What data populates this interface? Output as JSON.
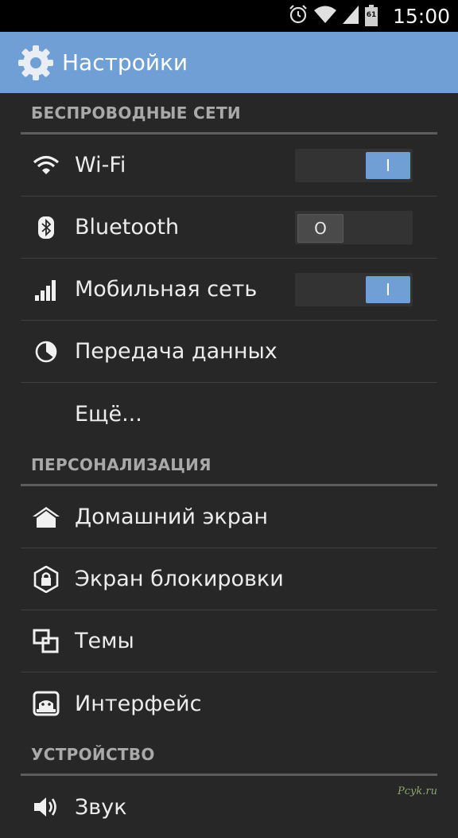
{
  "status_bar": {
    "time": "15:00",
    "battery_level": "61",
    "icons": [
      "alarm-icon",
      "wifi-signal-icon",
      "cell-signal-icon",
      "battery-icon"
    ]
  },
  "action_bar": {
    "title": "Настройки",
    "icon": "settings-gear-icon",
    "background_color": "#6f9fd4"
  },
  "sections": {
    "wireless": {
      "header": "БЕСПРОВОДНЫЕ СЕТИ",
      "items": [
        {
          "label": "Wi-Fi",
          "icon": "wifi-icon",
          "toggle_state": "on",
          "toggle_glyph": "I"
        },
        {
          "label": "Bluetooth",
          "icon": "bluetooth-icon",
          "toggle_state": "off",
          "toggle_glyph": "O"
        },
        {
          "label": "Мобильная сеть",
          "icon": "cell-signal-icon",
          "toggle_state": "on",
          "toggle_glyph": "I"
        },
        {
          "label": "Передача данных",
          "icon": "data-usage-icon"
        },
        {
          "label": "Ещё..."
        }
      ]
    },
    "personalization": {
      "header": "ПЕРСОНАЛИЗАЦИЯ",
      "items": [
        {
          "label": "Домашний экран",
          "icon": "home-icon"
        },
        {
          "label": "Экран блокировки",
          "icon": "lock-icon"
        },
        {
          "label": "Темы",
          "icon": "themes-icon"
        },
        {
          "label": "Интерфейс",
          "icon": "interface-icon"
        }
      ]
    },
    "device": {
      "header": "УСТРОЙСТВО",
      "items": [
        {
          "label": "Звук",
          "icon": "sound-icon"
        }
      ]
    }
  },
  "watermark": "Pcyk.ru",
  "colors": {
    "accent": "#6f9fd4",
    "background": "#272727",
    "section_header": "#a9a9a9"
  }
}
